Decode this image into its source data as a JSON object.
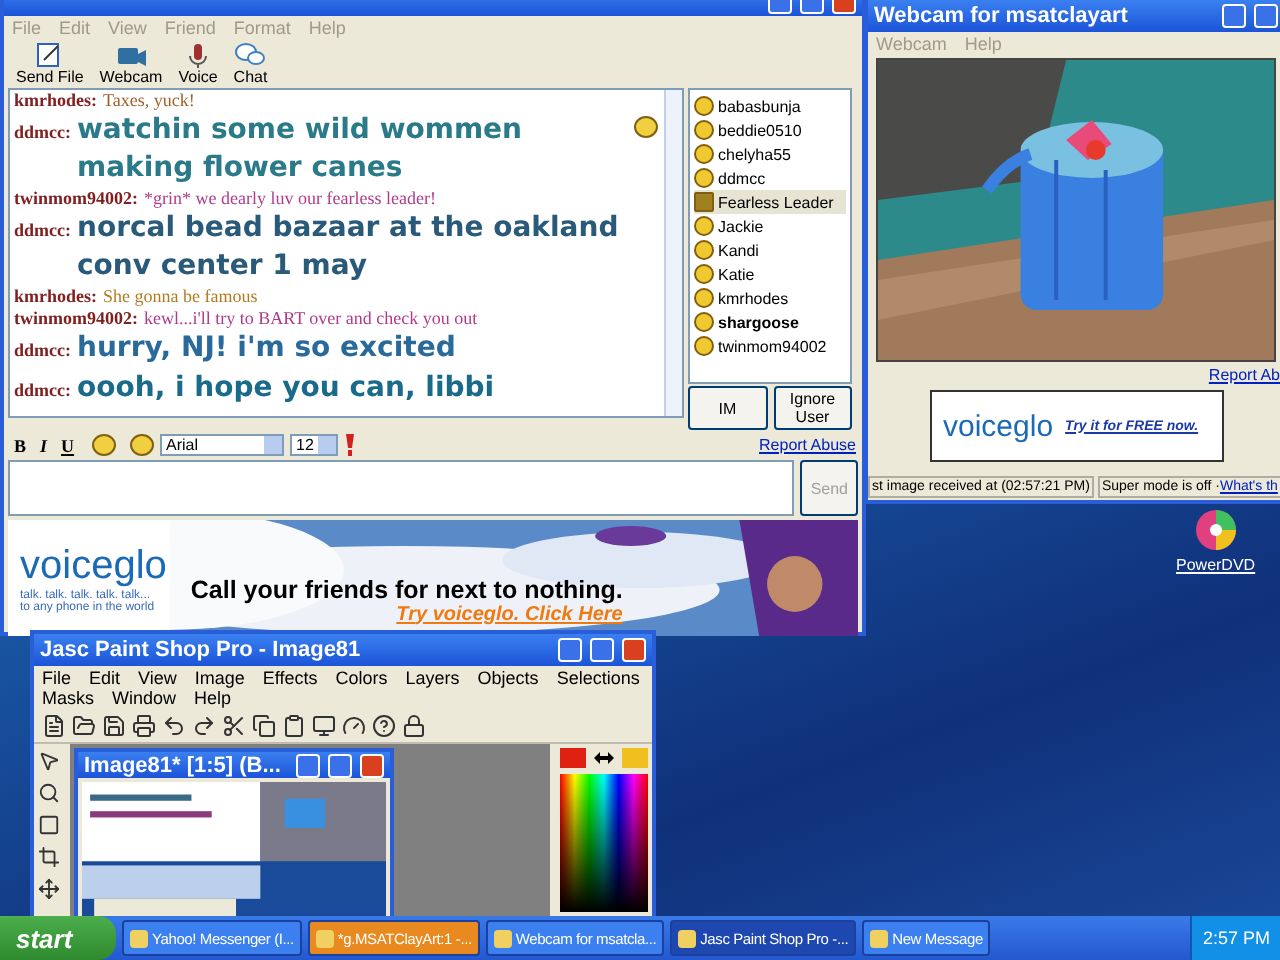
{
  "chat_window": {
    "menu": [
      "File",
      "Edit",
      "View",
      "Friend",
      "Format",
      "Help"
    ],
    "toolbar": [
      {
        "kind": "send_file",
        "label": "Send File"
      },
      {
        "kind": "webcam",
        "label": "Webcam"
      },
      {
        "kind": "voice",
        "label": "Voice"
      },
      {
        "kind": "chat",
        "label": "Chat"
      }
    ],
    "messages": [
      {
        "sender": "kmrhodes:",
        "text": "Taxes, yuck!",
        "kind": "plain",
        "color": "#a0602a",
        "emoticon": false
      },
      {
        "sender": "ddmcc:",
        "text": "watchin some wild wommen making flower canes",
        "kind": "large",
        "color": "#2a7a8a",
        "emoticon": true
      },
      {
        "sender": "twinmom94002:",
        "text": "*grin* we dearly luv our fearless leader!",
        "kind": "plain",
        "color": "#b03a8a",
        "emoticon": false
      },
      {
        "sender": "ddmcc:",
        "text": "norcal bead bazaar at the oakland conv center 1 may",
        "kind": "large",
        "color": "#2a5a7a",
        "emoticon": false
      },
      {
        "sender": "kmrhodes:",
        "text": "She gonna be famous",
        "kind": "plain",
        "color": "#b07a20",
        "emoticon": false
      },
      {
        "sender": "twinmom94002:",
        "text": "kewl...i'll try to BART over and check you out",
        "kind": "plain",
        "color": "#b03a8a",
        "emoticon": false
      },
      {
        "sender": "ddmcc:",
        "text": "hurry, NJ! i'm so excited",
        "kind": "large",
        "color": "#2a6a9a",
        "emoticon": false
      },
      {
        "sender": "ddmcc:",
        "text": "oooh, i hope you can, libbi",
        "kind": "large",
        "color": "#1a6a8a",
        "emoticon": false
      }
    ],
    "users": [
      {
        "name": "babasbunja",
        "kind": "smiley",
        "selected": false,
        "bold": false
      },
      {
        "name": "beddie0510",
        "kind": "smiley",
        "selected": false,
        "bold": false
      },
      {
        "name": "chelyha55",
        "kind": "smiley",
        "selected": false,
        "bold": false
      },
      {
        "name": "ddmcc",
        "kind": "smiley",
        "selected": false,
        "bold": false
      },
      {
        "name": "Fearless Leader",
        "kind": "webcam",
        "selected": true,
        "bold": false
      },
      {
        "name": "Jackie",
        "kind": "smiley",
        "selected": false,
        "bold": false
      },
      {
        "name": "Kandi",
        "kind": "smiley",
        "selected": false,
        "bold": false
      },
      {
        "name": "Katie",
        "kind": "smiley",
        "selected": false,
        "bold": false
      },
      {
        "name": "kmrhodes",
        "kind": "smiley",
        "selected": false,
        "bold": false
      },
      {
        "name": "shargoose",
        "kind": "smiley",
        "selected": false,
        "bold": true
      },
      {
        "name": "twinmom94002",
        "kind": "smiley",
        "selected": false,
        "bold": false
      }
    ],
    "user_buttons": [
      "IM",
      "Ignore User"
    ],
    "format_bar": {
      "bold": "B",
      "italic": "I",
      "underline": "U",
      "font": "Arial",
      "size": "12",
      "report": "Report Abuse"
    },
    "send": {
      "label": "Send",
      "disabled": true
    },
    "ad": {
      "brand": "voiceglo",
      "tagline": "talk. talk. talk. talk. talk...",
      "tagline2": "to any phone in the world",
      "headline": "Call your friends for next to nothing.",
      "link": "Try voiceglo. Click Here"
    }
  },
  "webcam_window": {
    "title": "Webcam for msatclayart",
    "menu": [
      "Webcam",
      "Help"
    ],
    "report": "Report Ab",
    "ad": {
      "brand": "voiceglo",
      "link": "Try it for FREE now."
    },
    "status": {
      "received": "st image received at (02:57:21 PM)",
      "mode": "Super mode is off · ",
      "link": "What's th"
    }
  },
  "desktop_icons": [
    {
      "label": "PowerDVD"
    }
  ],
  "psp_window": {
    "title": "Jasc Paint Shop Pro - Image81",
    "menu": [
      "File",
      "Edit",
      "View",
      "Image",
      "Effects",
      "Colors",
      "Layers",
      "Objects",
      "Selections",
      "Masks",
      "Window",
      "Help"
    ],
    "document_title": "Image81* [1:5] (B..."
  },
  "taskbar": {
    "start": "start",
    "tasks": [
      {
        "label": "Yahoo! Messenger (I...",
        "kind": "normal"
      },
      {
        "label": "*g.MSATClayArt:1 -...",
        "kind": "flashing"
      },
      {
        "label": "Webcam for msatcla...",
        "kind": "normal"
      },
      {
        "label": "Jasc Paint Shop Pro -...",
        "kind": "active"
      },
      {
        "label": "New Message",
        "kind": "normal"
      }
    ],
    "clock": "2:57 PM"
  }
}
